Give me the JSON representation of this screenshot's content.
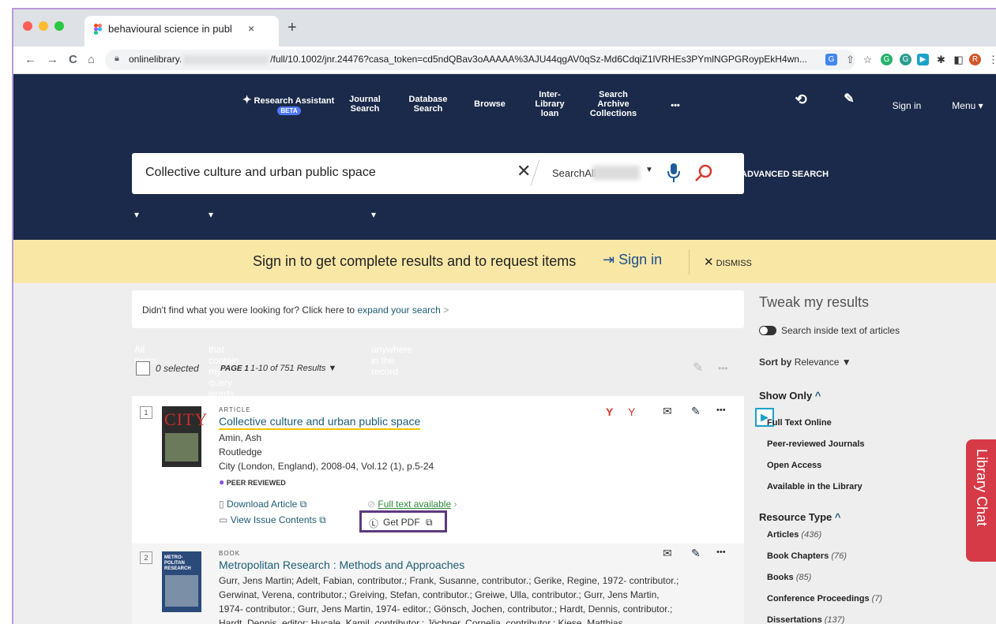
{
  "browser": {
    "tab_title": "behavioural science in publ",
    "tab_close": "×",
    "new_tab": "+",
    "url_prefix": "onlinelibrary.",
    "url_rest": "/full/10.1002/jnr.24476?casa_token=cd5ndQBav3oAAAAA%3AJU44qgAV0qSz-Md6CdqiZ1lVRHEs3PYmlNGPGRoypEkH4wn...",
    "back": "←",
    "forward": "→",
    "reload": "C",
    "home": "⌂",
    "avatar_letter": "R"
  },
  "nav": {
    "research_assistant": "Research Assistant",
    "beta": "BETA",
    "journal_search": "Journal Search",
    "database_search": "Database Search",
    "browse": "Browse",
    "interlibrary_loan": "Inter-Library loan",
    "search_archive": "Search Archive Collections",
    "more": "•••",
    "sign_in": "Sign in",
    "menu": "Menu"
  },
  "search": {
    "query": "Collective culture and urban public space",
    "scope": "SearchAll",
    "advanced": "ADVANCED SEARCH",
    "filter_all_items": "All items",
    "filter_contains": "that contain my query words",
    "filter_anywhere": "anywhere in the record"
  },
  "banner": {
    "message": "Sign in to get complete results and to request items",
    "sign_in": "Sign in",
    "dismiss": "DISMISS"
  },
  "expand": {
    "text": "Didn't find what you were looking for? Click here to",
    "link": "expand your search",
    "arrow": ">"
  },
  "results_bar": {
    "selected": "0 selected",
    "page": "PAGE 1",
    "range": "1-10 of 751 Results"
  },
  "records": [
    {
      "num": "1",
      "type": "ARTICLE",
      "title": "Collective culture and urban public space",
      "author": "Amin, Ash",
      "publisher": "Routledge",
      "source": "City (London, England), 2008-04, Vol.12 (1), p.5-24",
      "peer": "PEER REVIEWED",
      "download": "Download Article",
      "view_issue": "View Issue Contents",
      "full_text": "Full text available",
      "get_pdf": "Get PDF",
      "cover_text": "CITY"
    },
    {
      "num": "2",
      "type": "BOOK",
      "title": "Metropolitan Research : Methods and Approaches",
      "contrib1": "Gurr, Jens Martin; Adelt, Fabian, contributor.; Frank, Susanne, contributor.; Gerike, Regine, 1972- contributor.;",
      "contrib2": "Gerwinat, Verena, contributor.; Greiving, Stefan, contributor.; Greiwe, Ulla, contributor.; Gurr, Jens Martin,",
      "contrib3": "1974- contributor.; Gurr, Jens Martin, 1974- editor.; Gönsch, Jochen, contributor.; Hardt, Dennis, contributor.;",
      "contrib4": "Hardt, Dennis, editor; Hucale, Kamil, contributor.; Jöchner, Cornelia, contributor.; Kiese, Matthias",
      "cover_text": "METRO-POLITAN RESEARCH"
    }
  ],
  "sidebar": {
    "tweak": "Tweak my results",
    "search_inside": "Search inside text of articles",
    "sort_by": "Sort by",
    "sort_value": "Relevance",
    "show_only": "Show Only",
    "full_text": "Full Text Online",
    "peer_journals": "Peer-reviewed Journals",
    "open_access": "Open Access",
    "available": "Available in the Library",
    "resource_type": "Resource Type",
    "articles": "Articles",
    "articles_count": "(436)",
    "book_chapters": "Book Chapters",
    "book_chapters_count": "(76)",
    "books": "Books",
    "books_count": "(85)",
    "conf": "Conference Proceedings",
    "conf_count": "(7)",
    "diss": "Dissertations",
    "diss_count": "(137)"
  },
  "library_chat": "Library Chat",
  "colors": {
    "navy": "#1b2a4a",
    "banner": "#f9e7a6",
    "link": "#1d5d73",
    "chat": "#d63a46",
    "highlight": "#5b3a7e"
  }
}
